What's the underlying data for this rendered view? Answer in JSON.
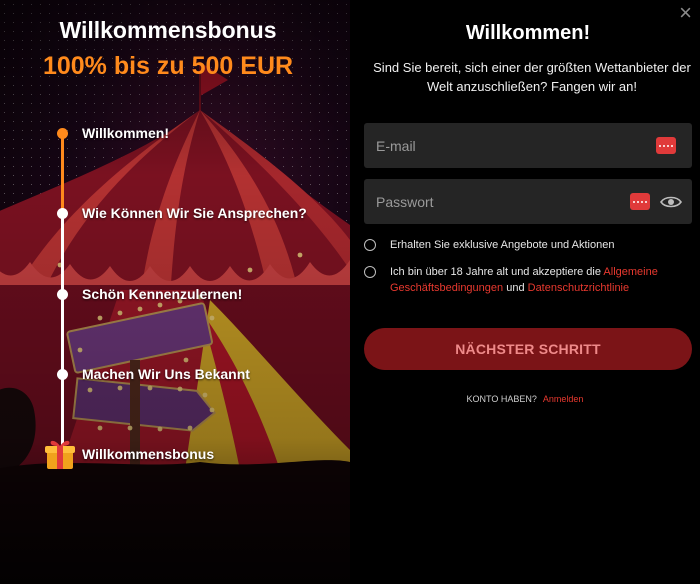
{
  "left_panel": {
    "title": "Willkommensbonus",
    "subtitle": "100% bis zu 500 EUR",
    "steps": [
      {
        "label": "Willkommen!"
      },
      {
        "label": "Wie Können Wir Sie Ansprechen?"
      },
      {
        "label": "Schön Kennenzulernen!"
      },
      {
        "label": "Machen Wir Uns Bekannt"
      },
      {
        "label": "Willkommensbonus"
      }
    ],
    "active_step": 1,
    "accent_color": "#ff8a1c",
    "background_art": "circus tent with signposts"
  },
  "dialog": {
    "close_icon": "×",
    "title": "Willkommen!",
    "subtitle": "Sind Sie bereit, sich einer der größten Wettanbieter der Welt anzuschließen? Fangen wir an!",
    "email": {
      "placeholder": "E-mail",
      "value": ""
    },
    "password": {
      "placeholder": "Passwort",
      "value": ""
    },
    "offers_checkbox": {
      "label": "Erhalten Sie exklusive Angebote und Aktionen",
      "checked": false
    },
    "terms_checkbox": {
      "text_before": "Ich bin über 18 Jahre alt und akzeptiere die ",
      "link1": "Allgemeine Geschäftsbedingungen",
      "text_middle": " und ",
      "link2": "Datenschutzrichtlinie",
      "checked": false
    },
    "next_button": "NÄCHSTER SCHRITT",
    "login_question": "KONTO HABEN?",
    "login_link": "Anmelden",
    "colors": {
      "link": "#e8392f",
      "button": "#7b1417",
      "field": "#252525"
    }
  }
}
